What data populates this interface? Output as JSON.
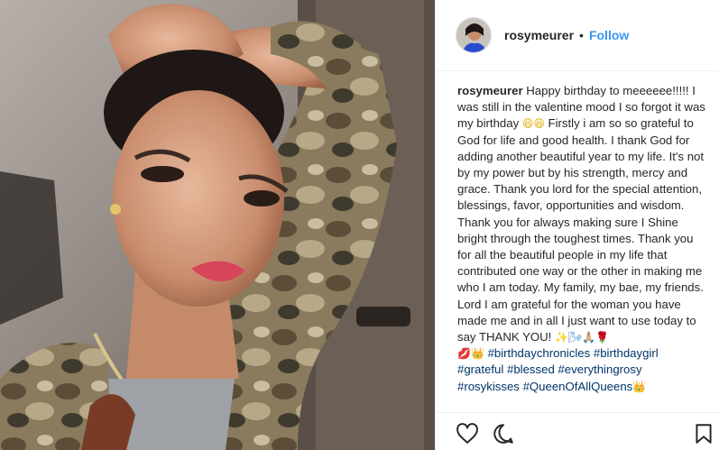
{
  "post": {
    "username": "rosymeurer",
    "separator": "•",
    "follow_label": "Follow",
    "caption": {
      "author": "rosymeurer",
      "text_1": "Happy birthday to meeeeee!!!!! I was still in the valentine mood I so forgot it was my birthday",
      "emoji_1": "😆😆",
      "text_2": "Firstly i am so so grateful to God for life and good health. I thank God for adding another beautiful year to my life. It's not by my power but by his strength, mercy and grace. Thank you lord for the special attention, blessings, favor, opportunities and wisdom. Thank you for always making sure I Shine bright through the toughest times. Thank you for all the beautiful people in my life that contributed one way or the other in making me who I am today. My family, my bae, my friends. Lord I am grateful for the woman you have made me and in all I just want to use today to say THANK YOU!",
      "emoji_2": "✨🌬🙏🏼🌹",
      "emoji_3": "💋👑",
      "hashtags_line1": [
        "#birthdaychronicles",
        "#birthdaygirl"
      ],
      "hashtags_line2": [
        "#grateful",
        "#blessed",
        "#everythingrosy"
      ],
      "hashtags_line3": [
        "#rosykisses",
        "#QueenOfAllQueens"
      ],
      "emoji_4": "👑"
    }
  },
  "icons": {
    "like": "heart-icon",
    "comment": "comment-icon",
    "save": "bookmark-icon"
  },
  "colors": {
    "link": "#003569",
    "follow": "#3897f0",
    "text": "#262626",
    "border": "#efefef"
  }
}
